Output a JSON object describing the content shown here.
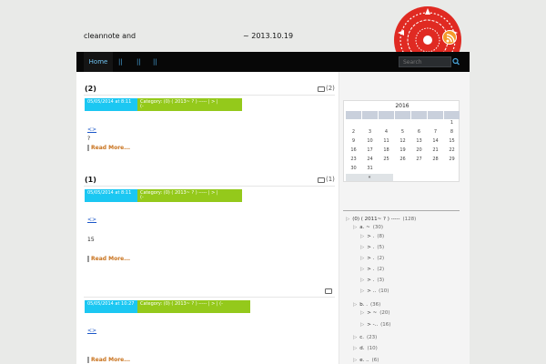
{
  "header": {
    "title": "cleannote and",
    "date": "~ 2013.10.19"
  },
  "nav": {
    "home": "Home",
    "sep1": "||",
    "sep2": "||",
    "sep3": "||",
    "search_placeholder": "Search"
  },
  "posts": [
    {
      "title": "(2)",
      "comments": "(2)",
      "date": "05/05/2014 at 8:11",
      "category": "Category: (0) ( 2013~ ? ) ----- | > |",
      "category_line2": "(-",
      "link": "<>",
      "text": "?",
      "read_more": "Read More..."
    },
    {
      "title": "(1)",
      "comments": "(1)",
      "date": "05/05/2014 at 8:11",
      "category": "Category: (0) ( 2013~ ? ) ----- | > |",
      "category_line2": "(-",
      "link": "<>",
      "text": "15",
      "read_more": "Read More..."
    },
    {
      "title": "",
      "comments": "",
      "date": "05/05/2014 at 10:27",
      "category": "Category: (0) ( 2013~ ? ) ----- | > | (-",
      "link": "<>",
      "read_more": "Read More..."
    }
  ],
  "calendar": {
    "year": "2016",
    "weeks": [
      [
        "",
        "",
        "",
        "",
        "",
        "",
        "1"
      ],
      [
        "2",
        "3",
        "4",
        "5",
        "6",
        "7",
        "8"
      ],
      [
        "9",
        "10",
        "11",
        "12",
        "13",
        "14",
        "15"
      ],
      [
        "16",
        "17",
        "18",
        "19",
        "20",
        "21",
        "22"
      ],
      [
        "23",
        "24",
        "25",
        "26",
        "27",
        "28",
        "29"
      ],
      [
        "30",
        "31",
        "",
        "",
        "",
        "",
        ""
      ]
    ],
    "prev": "«"
  },
  "categories": [
    {
      "label": "(0) ( 2011~ ? ) -----",
      "count": "(128)",
      "level": 0
    },
    {
      "label": "a. ~",
      "count": "(30)",
      "level": 1
    },
    {
      "label": "> .",
      "count": "(8)",
      "level": 2
    },
    {
      "label": "> .",
      "count": "(5)",
      "level": 2
    },
    {
      "label": "> .",
      "count": "(2)",
      "level": 2
    },
    {
      "label": "> .",
      "count": "(2)",
      "level": 2
    },
    {
      "label": "> .",
      "count": "(3)",
      "level": 2
    },
    {
      "label": "> ..",
      "count": "(10)",
      "level": 2
    },
    {
      "label": "b. .",
      "count": "(36)",
      "level": 1
    },
    {
      "label": "> ~",
      "count": "(20)",
      "level": 2
    },
    {
      "label": "> -..",
      "count": "(16)",
      "level": 2
    },
    {
      "label": "c.",
      "count": "(23)",
      "level": 1
    },
    {
      "label": "d.",
      "count": "(10)",
      "level": 1
    },
    {
      "label": "e. ..",
      "count": "(6)",
      "level": 1
    }
  ]
}
